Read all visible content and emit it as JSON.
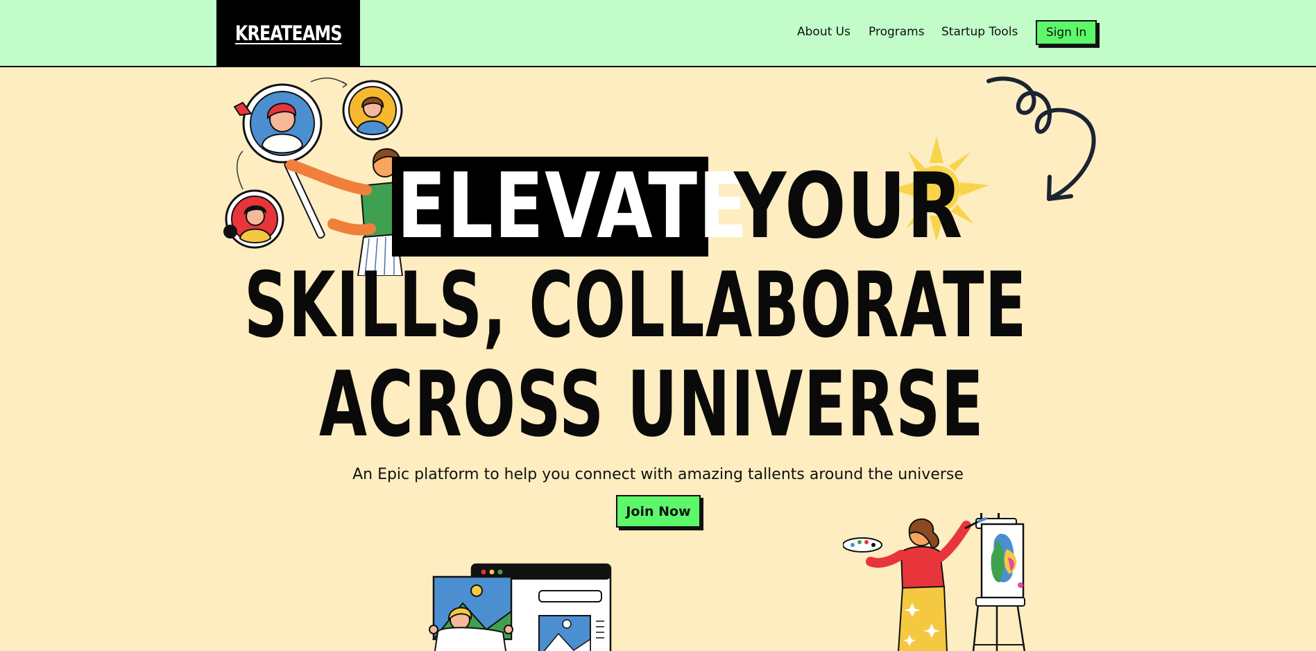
{
  "header": {
    "logo": "KREATEAMS",
    "nav": [
      "About Us",
      "Programs",
      "Startup Tools"
    ],
    "sign_in": "Sign In"
  },
  "hero": {
    "highlight_word": "ELEVATE",
    "line1_rest": "YOUR",
    "line2": "SKILLS, COLLABORATE",
    "line3": "ACROSS UNIVERSE",
    "subtitle": "An Epic platform to help you connect with amazing tallents around the universe",
    "cta": "Join Now"
  },
  "colors": {
    "background": "#fdedc0",
    "header_bg": "#c2fcc8",
    "accent_green": "#5cf86a",
    "ink": "#0a0a0a",
    "sun": "#f7d44a"
  },
  "icons": [
    "people-connect-illustration",
    "sun-icon",
    "swirl-arrow-icon",
    "browser-gallery-illustration",
    "painter-illustration"
  ]
}
